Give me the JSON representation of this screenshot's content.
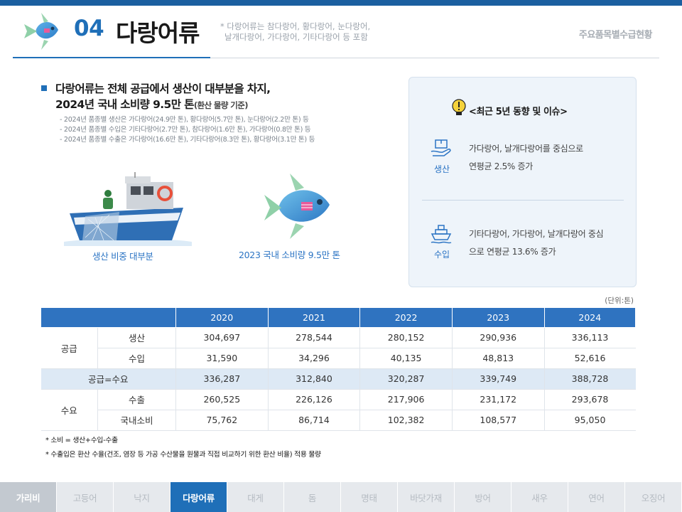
{
  "header": {
    "section_number": "04",
    "section_title": "다랑어류",
    "note_line1": "* 다랑어류는 참다랑어, 황다랑어, 눈다랑어,",
    "note_line2": "날개다랑어, 가다랑어, 기타다랑어 등 포함",
    "breadcrumb": "주요품목별수급현황"
  },
  "headline": {
    "line1": "다랑어류는 전체 공급에서 생산이 대부분을 차지,",
    "line2": "2024년 국내 소비량 9.5만 톤",
    "line2_small": "(환산 물량 기준)",
    "notes": [
      "- 2024년 품종별 생산은 가다랑어(24.9만 톤), 황다랑어(5.7만 톤), 눈다랑어(2.2만 톤) 등",
      "- 2024년 품종별 수입은 기타다랑어(2.7만 톤), 참다랑어(1.6만 톤), 가다랑어(0.8만 톤) 등",
      "- 2024년 품종별 수출은 가다랑어(16.6만 톤), 기타다랑어(8.3만 톤), 황다랑어(3.1만 톤) 등"
    ]
  },
  "illustrations": {
    "boat_caption": "생산 비중 대부분",
    "fish_caption": "2023 국내 소비량 9.5만 톤"
  },
  "trend": {
    "title": "<최근 5년 동향 및 이슈>",
    "items": [
      {
        "icon": "hand-box-icon",
        "label": "생산",
        "desc_line1": "가다랑어, 날개다랑어를 중심으로",
        "desc_line2": "연평균 2.5% 증가"
      },
      {
        "icon": "ship-icon",
        "label": "수입",
        "desc_line1": "기타다랑어, 가다랑어, 날개다랑어 중심",
        "desc_line2": "으로 연평균 13.6% 증가"
      }
    ]
  },
  "table": {
    "unit": "(단위:톤)",
    "years": [
      "2020",
      "2021",
      "2022",
      "2023",
      "2024"
    ],
    "rows": [
      {
        "group": "공급",
        "label": "생산",
        "values": [
          "304,697",
          "278,544",
          "280,152",
          "290,936",
          "336,113"
        ]
      },
      {
        "group": "공급",
        "label": "수입",
        "values": [
          "31,590",
          "34,296",
          "40,135",
          "48,813",
          "52,616"
        ]
      },
      {
        "group": "",
        "label": "공급=수요",
        "values": [
          "336,287",
          "312,840",
          "320,287",
          "339,749",
          "388,728"
        ]
      },
      {
        "group": "수요",
        "label": "수출",
        "values": [
          "260,525",
          "226,126",
          "217,906",
          "231,172",
          "293,678"
        ]
      },
      {
        "group": "수요",
        "label": "국내소비",
        "values": [
          "75,762",
          "86,714",
          "102,382",
          "108,577",
          "95,050"
        ]
      }
    ],
    "group_supply": "공급",
    "group_demand": "수요"
  },
  "footnotes": [
    "* 소비 = 생산+수입-수출",
    "* 수출입은 환산 수율(건조, 염장 등 가공 수산물을 원물과 직접 비교하기 위한 환산 비율) 적용 물량"
  ],
  "nav": {
    "items": [
      "가리비",
      "고등어",
      "낙지",
      "다랑어류",
      "대게",
      "돔",
      "명태",
      "바닷가재",
      "방어",
      "새우",
      "연어",
      "오징어"
    ],
    "active_index": 3
  },
  "colors": {
    "accent": "#1f6fb8",
    "header_bar": "#1b5fa0",
    "table_header": "#2f73c0",
    "sum_row": "#dde9f5",
    "trend_box": "#eef4fa"
  }
}
